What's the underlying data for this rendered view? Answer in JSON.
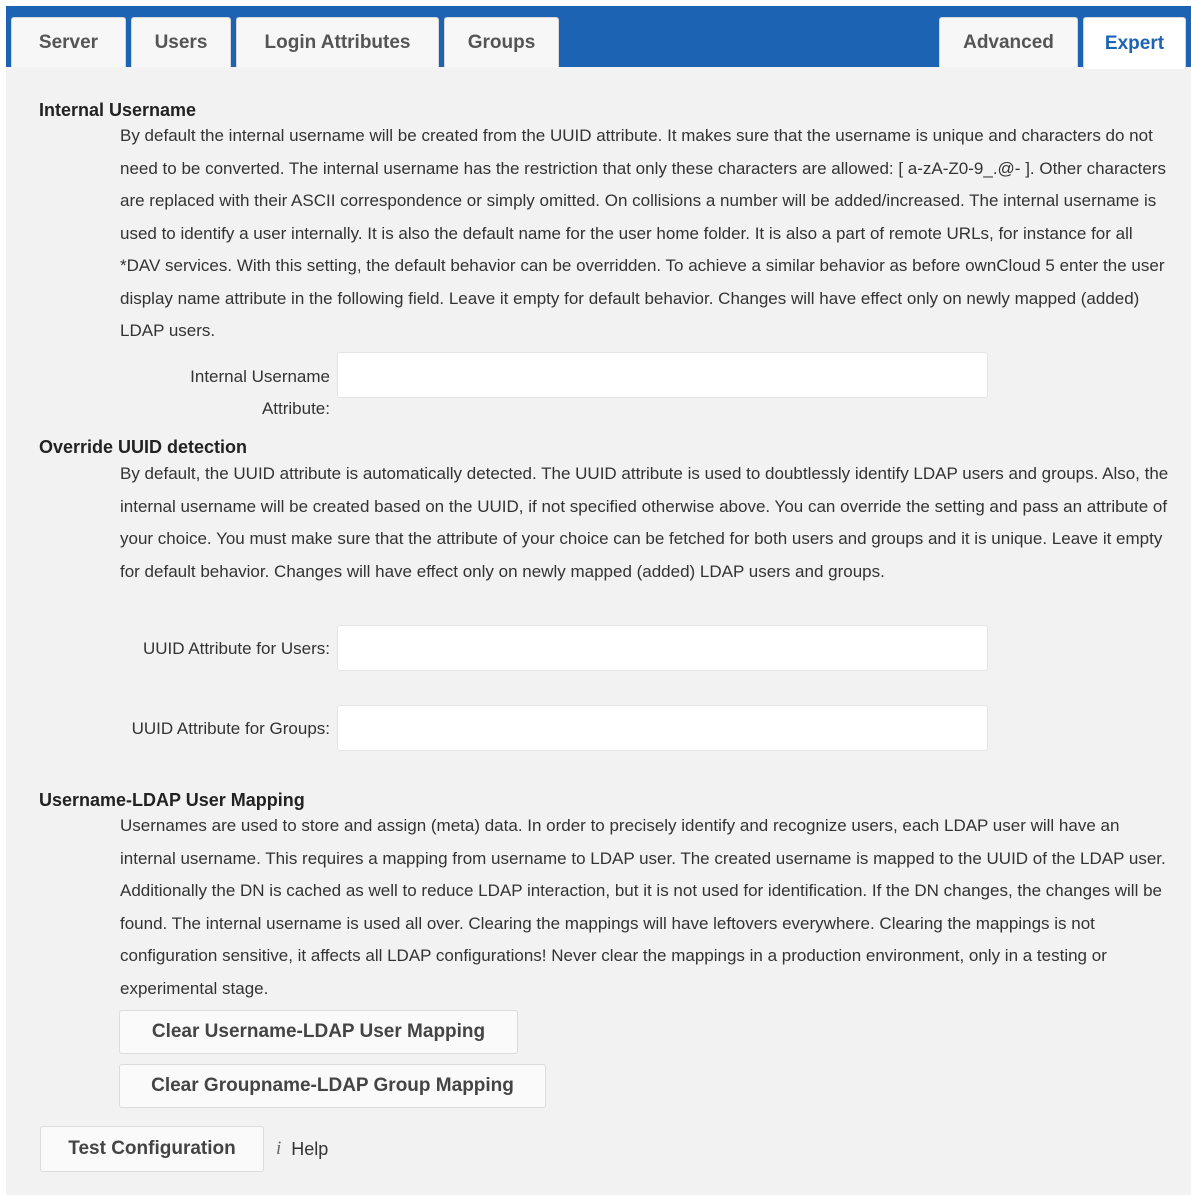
{
  "tabs": [
    {
      "label": "Server"
    },
    {
      "label": "Users"
    },
    {
      "label": "Login Attributes"
    },
    {
      "label": "Groups"
    },
    {
      "label": "Advanced"
    },
    {
      "label": "Expert",
      "active": true
    }
  ],
  "accent_color": "#1d63b3",
  "sections": {
    "internal_username": {
      "title": "Internal Username",
      "description": "By default the internal username will be created from the UUID attribute. It makes sure that the username is unique and characters do not need to be converted. The internal username has the restriction that only these characters are allowed: [ a-zA-Z0-9_.@- ]. Other characters are replaced with their ASCII correspondence or simply omitted. On collisions a number will be added/increased. The internal username is used to identify a user internally. It is also the default name for the user home folder. It is also a part of remote URLs, for instance for all *DAV services. With this setting, the default behavior can be overridden. To achieve a similar behavior as before ownCloud 5 enter the user display name attribute in the following field. Leave it empty for default behavior. Changes will have effect only on newly mapped (added) LDAP users.",
      "field_label": "Internal Username Attribute:",
      "field_value": ""
    },
    "override_uuid": {
      "title": "Override UUID detection",
      "description": "By default, the UUID attribute is automatically detected. The UUID attribute is used to doubtlessly identify LDAP users and groups. Also, the internal username will be created based on the UUID, if not specified otherwise above. You can override the setting and pass an attribute of your choice. You must make sure that the attribute of your choice can be fetched for both users and groups and it is unique. Leave it empty for default behavior. Changes will have effect only on newly mapped (added) LDAP users and groups.",
      "users_label": "UUID Attribute for Users:",
      "users_value": "",
      "groups_label": "UUID Attribute for Groups:",
      "groups_value": ""
    },
    "mapping": {
      "title": "Username-LDAP User Mapping",
      "description": "Usernames are used to store and assign (meta) data. In order to precisely identify and recognize users, each LDAP user will have an internal username. This requires a mapping from username to LDAP user. The created username is mapped to the UUID of the LDAP user. Additionally the DN is cached as well to reduce LDAP interaction, but it is not used for identification. If the DN changes, the changes will be found. The internal username is used all over. Clearing the mappings will have leftovers everywhere. Clearing the mappings is not configuration sensitive, it affects all LDAP configurations! Never clear the mappings in a production environment, only in a testing or experimental stage.",
      "clear_user_button": "Clear Username-LDAP User Mapping",
      "clear_group_button": "Clear Groupname-LDAP Group Mapping"
    }
  },
  "footer": {
    "test_button": "Test Configuration",
    "help_icon": "info-icon",
    "help_glyph": "i",
    "help_label": "Help"
  }
}
